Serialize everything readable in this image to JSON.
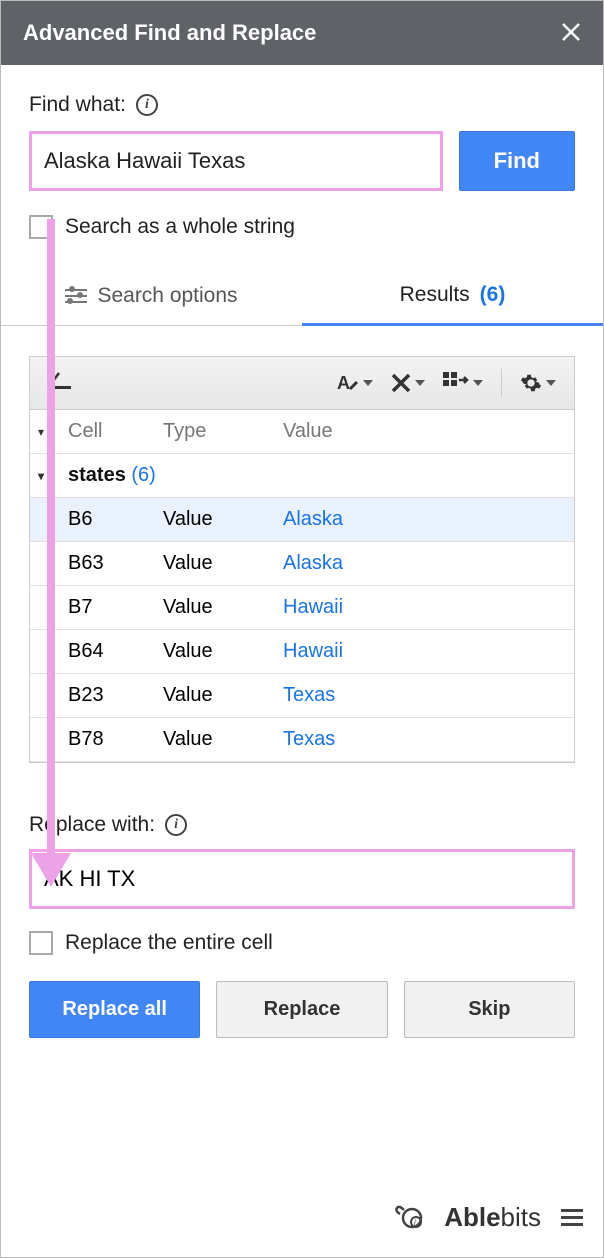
{
  "header": {
    "title": "Advanced Find and Replace"
  },
  "find": {
    "label": "Find what:",
    "value": "Alaska Hawaii Texas",
    "button": "Find",
    "whole_string_label": "Search as a whole string"
  },
  "tabs": {
    "options_label": "Search options",
    "results_label": "Results",
    "results_count": "(6)"
  },
  "table": {
    "headers": {
      "cell": "Cell",
      "type": "Type",
      "value": "Value"
    },
    "group": {
      "name": "states",
      "count": "(6)"
    },
    "rows": [
      {
        "cell": "B6",
        "type": "Value",
        "value": "Alaska",
        "selected": true
      },
      {
        "cell": "B63",
        "type": "Value",
        "value": "Alaska",
        "selected": false
      },
      {
        "cell": "B7",
        "type": "Value",
        "value": "Hawaii",
        "selected": false
      },
      {
        "cell": "B64",
        "type": "Value",
        "value": "Hawaii",
        "selected": false
      },
      {
        "cell": "B23",
        "type": "Value",
        "value": "Texas",
        "selected": false
      },
      {
        "cell": "B78",
        "type": "Value",
        "value": "Texas",
        "selected": false
      }
    ]
  },
  "replace": {
    "label": "Replace with:",
    "value": "AK HI TX",
    "entire_cell_label": "Replace the entire cell"
  },
  "actions": {
    "replace_all": "Replace all",
    "replace": "Replace",
    "skip": "Skip"
  },
  "footer": {
    "brand_bold": "Able",
    "brand_rest": "bits"
  }
}
